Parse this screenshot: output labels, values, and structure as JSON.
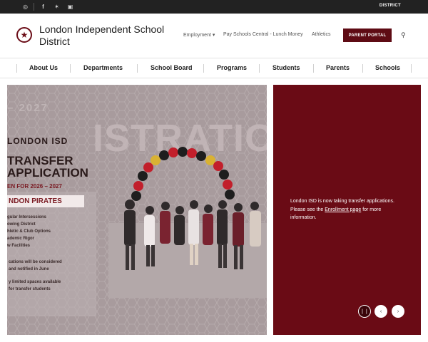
{
  "topbar": {
    "icons": [
      "translate-icon",
      "facebook-icon",
      "twitter-icon",
      "instagram-icon"
    ],
    "icon_glyphs": [
      "◎",
      "f",
      "✶",
      "▣"
    ],
    "district_label": "DISTRICT"
  },
  "header": {
    "title": "London Independent School District",
    "nav": {
      "employment": "Employment",
      "employment_caret": "▾",
      "pay_schools": "Pay Schools Central - Lunch Money",
      "athletics": "Athletics"
    },
    "portal_label": "PARENT PORTAL",
    "logo_glyph": "★",
    "search_glyph": "⚲"
  },
  "mainnav": {
    "items": [
      "About Us",
      "Departments",
      "School Board",
      "Programs",
      "Students",
      "Parents",
      "Schools"
    ]
  },
  "hero": {
    "poster": {
      "year_top": "– 2027",
      "district": "LONDON ISD",
      "line1": "TRANSFER",
      "line2": "APPLICATION",
      "open": "EN FOR 2026 – 2027",
      "pill": "NDON PIRATES",
      "list": [
        "gular Intersessions",
        "owing District",
        "hletic & Club Options",
        "ademic Rigor",
        "w Facilities"
      ],
      "note1": "cations will be considered",
      "note2": "and notified in June",
      "note3": "y limited spaces available",
      "note4": "for transfer students",
      "watermark": "ISTRATIO"
    },
    "caption_before_link": "London ISD is now taking transfer applications. Please see the ",
    "caption_link": "Enrollment page",
    "caption_after_link": " for more information.",
    "controls": {
      "pause_glyph": "❘❘",
      "prev_glyph": "‹",
      "next_glyph": "›"
    }
  },
  "colors": {
    "brand": "#6a0b15",
    "topbar": "#222222",
    "portal": "#5e0b14"
  }
}
